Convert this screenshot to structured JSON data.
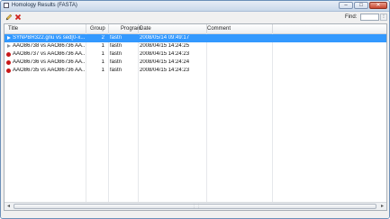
{
  "window": {
    "title": "Homology Results (FASTA)",
    "controls": {
      "minimize": "–",
      "maximize": "□",
      "close": "✕"
    }
  },
  "toolbar": {
    "edit_icon": "pencil-icon",
    "delete_icon": "delete-x-icon",
    "find_label": "Find:",
    "find_value": ""
  },
  "table": {
    "columns": [
      {
        "key": "title",
        "label": "Title"
      },
      {
        "key": "group",
        "label": "Group"
      },
      {
        "key": "program",
        "label": "Program"
      },
      {
        "key": "date",
        "label": "Date"
      },
      {
        "key": "comment",
        "label": "Comment"
      }
    ],
    "rows": [
      {
        "marker": "triangle",
        "selected": true,
        "title": "SYNPBR322.gnu vs sed[0-x...",
        "group": "2",
        "program": "fastn",
        "date": "2008/05/14 09:49:17",
        "comment": ""
      },
      {
        "marker": "triangle",
        "selected": false,
        "title": "AAO86738 vs AAO86736 AA...",
        "group": "1",
        "program": "fastn",
        "date": "2008/04/15 14:24:25",
        "comment": ""
      },
      {
        "marker": "dot",
        "selected": false,
        "title": "AAO86737 vs AAO86736 AA...",
        "group": "1",
        "program": "fastn",
        "date": "2008/04/15 14:24:23",
        "comment": ""
      },
      {
        "marker": "dot",
        "selected": false,
        "title": "AAO86736 vs AAO86736 AA...",
        "group": "1",
        "program": "fastn",
        "date": "2008/04/15 14:24:24",
        "comment": ""
      },
      {
        "marker": "dot",
        "selected": false,
        "title": "AAO86735 vs AAO86736 AA...",
        "group": "1",
        "program": "fastn",
        "date": "2008/04/15 14:24:23",
        "comment": ""
      }
    ]
  },
  "colors": {
    "selection": "#3399ff",
    "error_dot": "#c81818",
    "window_border": "#6b8fb8"
  }
}
